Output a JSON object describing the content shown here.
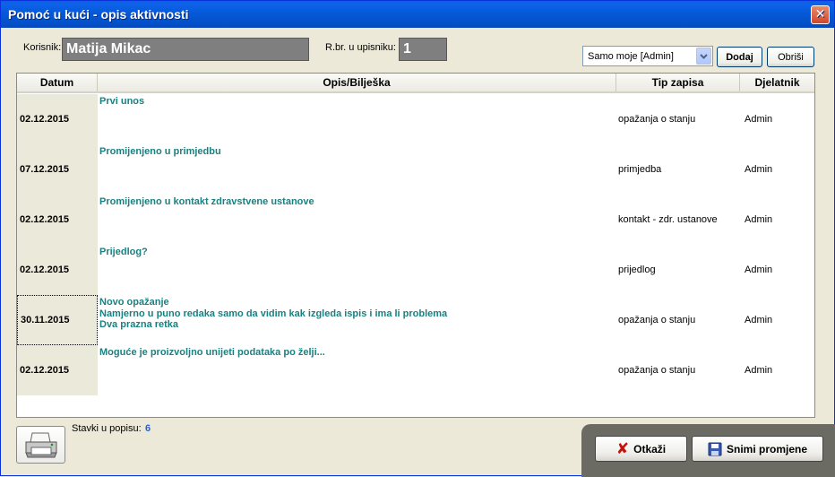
{
  "window": {
    "title": "Pomoć u kući - opis aktivnosti"
  },
  "top": {
    "korisnik_label": "Korisnik:",
    "korisnik_value": "Matija Mikac",
    "rbr_label": "R.br. u upisniku:",
    "rbr_value": "1",
    "filter_value": "Samo moje [Admin]",
    "dodaj_label": "Dodaj",
    "obrisi_label": "Obriši"
  },
  "grid": {
    "headers": [
      "Datum",
      "Opis/Bilješka",
      "Tip zapisa",
      "Djelatnik"
    ],
    "rows": [
      {
        "datum": "02.12.2015",
        "opis": "Prvi unos",
        "tip": "opažanja o stanju",
        "djelatnik": "Admin"
      },
      {
        "datum": "07.12.2015",
        "opis": "Promijenjeno u primjedbu",
        "tip": "primjedba",
        "djelatnik": "Admin"
      },
      {
        "datum": "02.12.2015",
        "opis": "Promijenjeno u kontakt zdravstvene ustanove",
        "tip": "kontakt - zdr. ustanove",
        "djelatnik": "Admin"
      },
      {
        "datum": "02.12.2015",
        "opis": "Prijedlog?",
        "tip": "prijedlog",
        "djelatnik": "Admin"
      },
      {
        "datum": "30.11.2015",
        "opis": "Novo opažanje\nNamjerno u puno redaka samo da vidim kak izgleda ispis i ima li problema\nDva prazna retka",
        "tip": "opažanja o stanju",
        "djelatnik": "Admin"
      },
      {
        "datum": "02.12.2015",
        "opis": "Moguće je proizvoljno unijeti podataka po želji...",
        "tip": "opažanja o stanju",
        "djelatnik": "Admin"
      }
    ]
  },
  "footer": {
    "stavki_label": "Stavki u popisu:",
    "stavki_value": "6",
    "otkazi_label": "Otkaži",
    "snimi_label": "Snimi promjene"
  }
}
